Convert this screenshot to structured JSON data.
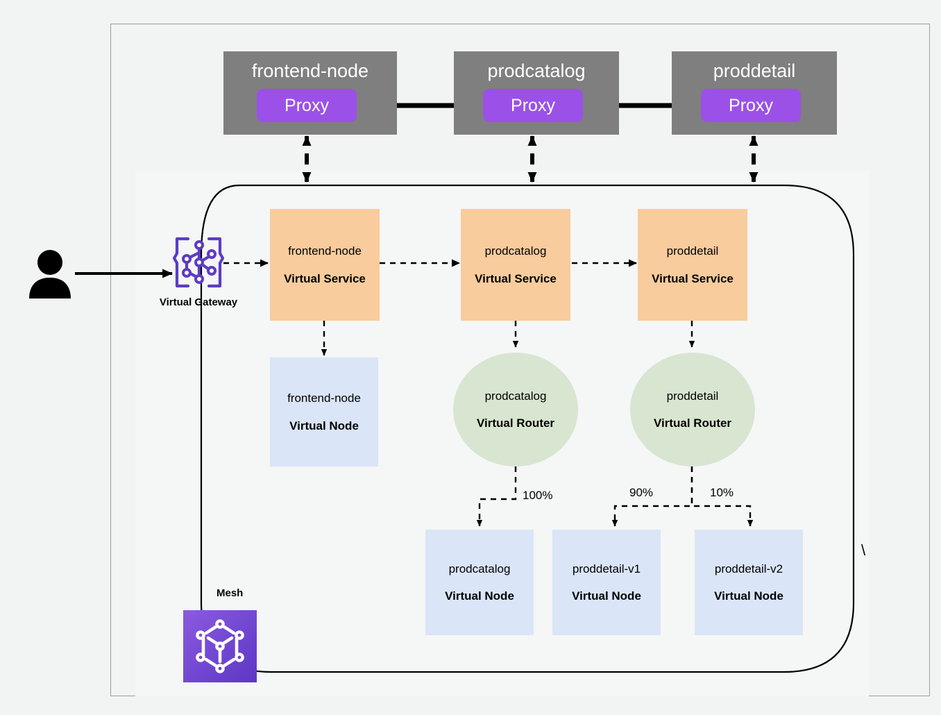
{
  "diagram": {
    "title": "AWS App Mesh service mesh architecture",
    "colors": {
      "background": "#f2f3f3",
      "service_box": "#7f7f7f",
      "proxy": "#9b51e8",
      "virtual_service": "#f8cc9c",
      "virtual_node": "#dae5f8",
      "virtual_router": "#d8e5d0",
      "mesh_icon_start": "#8c5ae0",
      "mesh_icon_end": "#5b37c4",
      "gateway_icon": "#5c3cc4",
      "connector": "#000000"
    },
    "services": [
      {
        "title": "frontend-node",
        "proxy_label": "Proxy"
      },
      {
        "title": "prodcatalog",
        "proxy_label": "Proxy"
      },
      {
        "title": "proddetail",
        "proxy_label": "Proxy"
      }
    ],
    "actor": {
      "name": "user-icon"
    },
    "gateway": {
      "label": "Virtual Gateway",
      "icon": "virtual-gateway-icon"
    },
    "mesh": {
      "label": "Mesh",
      "icon": "mesh-icon"
    },
    "virtual_services": [
      {
        "name": "frontend-node",
        "kind": "Virtual Service"
      },
      {
        "name": "prodcatalog",
        "kind": "Virtual Service"
      },
      {
        "name": "proddetail",
        "kind": "Virtual Service"
      }
    ],
    "virtual_routers": [
      {
        "name": "prodcatalog",
        "kind": "Virtual Router"
      },
      {
        "name": "proddetail",
        "kind": "Virtual Router"
      }
    ],
    "virtual_nodes": [
      {
        "name": "frontend-node",
        "kind": "Virtual Node"
      },
      {
        "name": "prodcatalog",
        "kind": "Virtual Node"
      },
      {
        "name": "proddetail-v1",
        "kind": "Virtual Node"
      },
      {
        "name": "proddetail-v2",
        "kind": "Virtual Node"
      }
    ],
    "weights": [
      {
        "label": "100%",
        "from": "prodcatalog Virtual Router",
        "to": "prodcatalog Virtual Node"
      },
      {
        "label": "90%",
        "from": "proddetail Virtual Router",
        "to": "proddetail-v1 Virtual Node"
      },
      {
        "label": "10%",
        "from": "proddetail Virtual Router",
        "to": "proddetail-v2 Virtual Node"
      }
    ],
    "stray_glyph": "\\"
  }
}
